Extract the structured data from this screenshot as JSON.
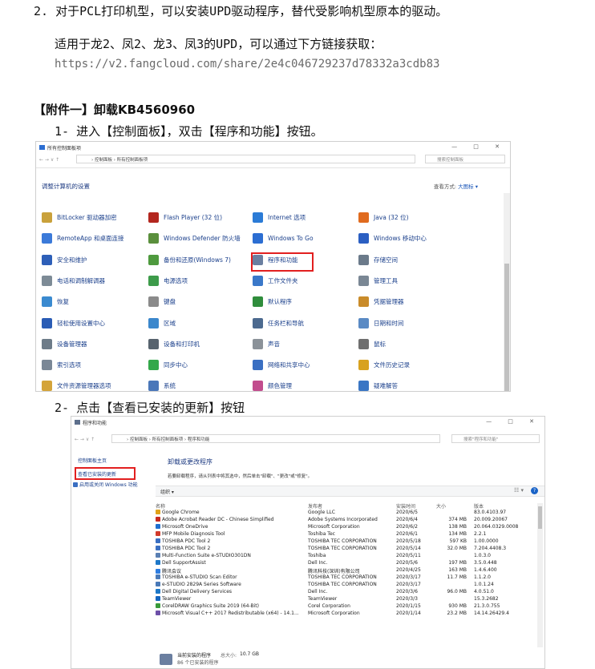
{
  "doc": {
    "line1": "2. 对于PCL打印机型，可以安装UPD驱动程序，替代受影响机型原本的驱动。",
    "line2": "适用于龙2、凤2、龙3、凤3的UPD，可以通过下方链接获取：",
    "url": "https://v2.fangcloud.com/share/2e4c046729237d78332a3cdb83",
    "attachment_heading": "【附件一】卸载KB4560960",
    "step1": "1- 进入【控制面板】，双击【程序和功能】按钮。",
    "step2": "2- 点击【查看已安装的更新】按钮"
  },
  "shot1": {
    "title": "所有控制面板项",
    "window_controls": "— □ ✕",
    "breadcrumb": "› 控制面板 › 所有控制面板项",
    "search_placeholder": "搜索控制面板",
    "header": "调整计算机的设置",
    "view_by_label": "查看方式:",
    "view_by_value": "大图标 ▾",
    "items": [
      {
        "label": "BitLocker 驱动器加密",
        "color": "#c9a13b"
      },
      {
        "label": "Flash Player (32 位)",
        "color": "#b3261e"
      },
      {
        "label": "Internet 选项",
        "color": "#2b7bd6"
      },
      {
        "label": "Java (32 位)",
        "color": "#e06b1f"
      },
      {
        "label": "RemoteApp 和桌面连接",
        "color": "#3b7ad9"
      },
      {
        "label": "Windows Defender 防火墙",
        "color": "#5a8f3c"
      },
      {
        "label": "Windows To Go",
        "color": "#2c6ed2"
      },
      {
        "label": "Windows 移动中心",
        "color": "#2b5fc2"
      },
      {
        "label": "安全和维护",
        "color": "#2d5fb8"
      },
      {
        "label": "备份和还原(Windows 7)",
        "color": "#4e9a3e"
      },
      {
        "label": "程序和功能",
        "color": "#6b7fa0"
      },
      {
        "label": "存储空间",
        "color": "#6b7a8a"
      },
      {
        "label": "电话和调制解调器",
        "color": "#7d8b96"
      },
      {
        "label": "电源选项",
        "color": "#3d9b4a"
      },
      {
        "label": "工作文件夹",
        "color": "#3a78c9"
      },
      {
        "label": "管理工具",
        "color": "#7a8794"
      },
      {
        "label": "恢复",
        "color": "#3a8ad0"
      },
      {
        "label": "键盘",
        "color": "#8a8a8a"
      },
      {
        "label": "默认程序",
        "color": "#2f8d3c"
      },
      {
        "label": "凭据管理器",
        "color": "#c98b2a"
      },
      {
        "label": "轻松使用设置中心",
        "color": "#2a5cb5"
      },
      {
        "label": "区域",
        "color": "#3b87cc"
      },
      {
        "label": "任务栏和导航",
        "color": "#4c6a8f"
      },
      {
        "label": "日期和时间",
        "color": "#5a8ac4"
      },
      {
        "label": "设备管理器",
        "color": "#6d7b88"
      },
      {
        "label": "设备和打印机",
        "color": "#57636e"
      },
      {
        "label": "声音",
        "color": "#8b9299"
      },
      {
        "label": "鼠标",
        "color": "#6f6f6f"
      },
      {
        "label": "索引选项",
        "color": "#7a8796"
      },
      {
        "label": "同步中心",
        "color": "#33a84a"
      },
      {
        "label": "网络和共享中心",
        "color": "#3a6fc2"
      },
      {
        "label": "文件历史记录",
        "color": "#d8a21f"
      },
      {
        "label": "文件资源管理器选项",
        "color": "#d4a43a"
      },
      {
        "label": "系统",
        "color": "#4a77b9"
      },
      {
        "label": "颜色管理",
        "color": "#c24d8e"
      },
      {
        "label": "疑难解答",
        "color": "#3b76c4"
      }
    ]
  },
  "shot2": {
    "title": "程序和功能",
    "window_controls": "— □ ✕",
    "breadcrumb": "› 控制面板 › 所有控制面板项 › 程序和功能",
    "search_placeholder": "搜索\"程序和功能\"",
    "nav_home": "控制面板主页",
    "nav_updates": "查看已安装的更新",
    "nav_features": "启用或关闭 Windows 功能",
    "heading": "卸载或更改程序",
    "subheading": "若要卸载程序，请从列表中将其选中，然后单击\"卸载\"、\"更改\"或\"修复\"。",
    "organize": "组织 ▾",
    "columns": {
      "name": "名称",
      "publisher": "发布者",
      "installed": "安装时间",
      "size": "大小",
      "version": "版本"
    },
    "rows": [
      {
        "name": "Google Chrome",
        "publisher": "Google LLC",
        "installed": "2020/6/5",
        "size": "",
        "version": "83.0.4103.97",
        "color": "#e0a21a"
      },
      {
        "name": "Adobe Acrobat Reader DC - Chinese Simplified",
        "publisher": "Adobe Systems Incorporated",
        "installed": "2020/6/4",
        "size": "374 MB",
        "version": "20.009.20067",
        "color": "#c8291f"
      },
      {
        "name": "Microsoft OneDrive",
        "publisher": "Microsoft Corporation",
        "installed": "2020/6/2",
        "size": "138 MB",
        "version": "20.064.0329.0008",
        "color": "#1f6fd0"
      },
      {
        "name": "MFP Mobile Diagnosis Tool",
        "publisher": "Toshiba Tec",
        "installed": "2020/6/1",
        "size": "134 MB",
        "version": "2.2.1",
        "color": "#d23b2b"
      },
      {
        "name": "TOSHIBA PDC Tool 2",
        "publisher": "TOSHIBA TEC CORPORATION",
        "installed": "2020/5/18",
        "size": "597 KB",
        "version": "1.00.0000",
        "color": "#3a6fc2"
      },
      {
        "name": "TOSHIBA PDC Tool 2",
        "publisher": "TOSHIBA TEC CORPORATION",
        "installed": "2020/5/14",
        "size": "32.0 MB",
        "version": "7.204.4408.3",
        "color": "#3a6fc2"
      },
      {
        "name": "Multi-Function Suite e-STUDIO301DN",
        "publisher": "Toshiba",
        "installed": "2020/5/11",
        "size": "",
        "version": "1.0.3.0",
        "color": "#5a7fb3"
      },
      {
        "name": "Dell SupportAssist",
        "publisher": "Dell Inc.",
        "installed": "2020/5/6",
        "size": "197 MB",
        "version": "3.5.0.448",
        "color": "#1e78c8"
      },
      {
        "name": "腾讯会议",
        "publisher": "腾讯科技(深圳)有限公司",
        "installed": "2020/4/25",
        "size": "163 MB",
        "version": "1.4.6.400",
        "color": "#2d7de0"
      },
      {
        "name": "TOSHIBA e-STUDIO Scan Editor",
        "publisher": "TOSHIBA TEC CORPORATION",
        "installed": "2020/3/17",
        "size": "11.7 MB",
        "version": "1.1.2.0",
        "color": "#4a7ab8"
      },
      {
        "name": "e-STUDIO 2829A Series Software",
        "publisher": "TOSHIBA TEC CORPORATION",
        "installed": "2020/3/17",
        "size": "",
        "version": "1.0.1.24",
        "color": "#4a7ab8"
      },
      {
        "name": "Dell Digital Delivery Services",
        "publisher": "Dell Inc.",
        "installed": "2020/3/6",
        "size": "96.0 MB",
        "version": "4.0.51.0",
        "color": "#1e78c8"
      },
      {
        "name": "TeamViewer",
        "publisher": "TeamViewer",
        "installed": "2020/3/3",
        "size": "",
        "version": "15.3.2682",
        "color": "#1565c0"
      },
      {
        "name": "CorelDRAW Graphics Suite 2019 (64-Bit)",
        "publisher": "Corel Corporation",
        "installed": "2020/1/15",
        "size": "930 MB",
        "version": "21.3.0.755",
        "color": "#3a9b3a"
      },
      {
        "name": "Microsoft Visual C++ 2017 Redistributable (x64) - 14.1...",
        "publisher": "Microsoft Corporation",
        "installed": "2020/1/14",
        "size": "23.2 MB",
        "version": "14.14.26429.4",
        "color": "#6d4fa8"
      }
    ],
    "status_label": "当前安装的程序",
    "status_total_label": "总大小:",
    "status_total": "10.7 GB",
    "status_count": "86 个已安装的程序"
  }
}
